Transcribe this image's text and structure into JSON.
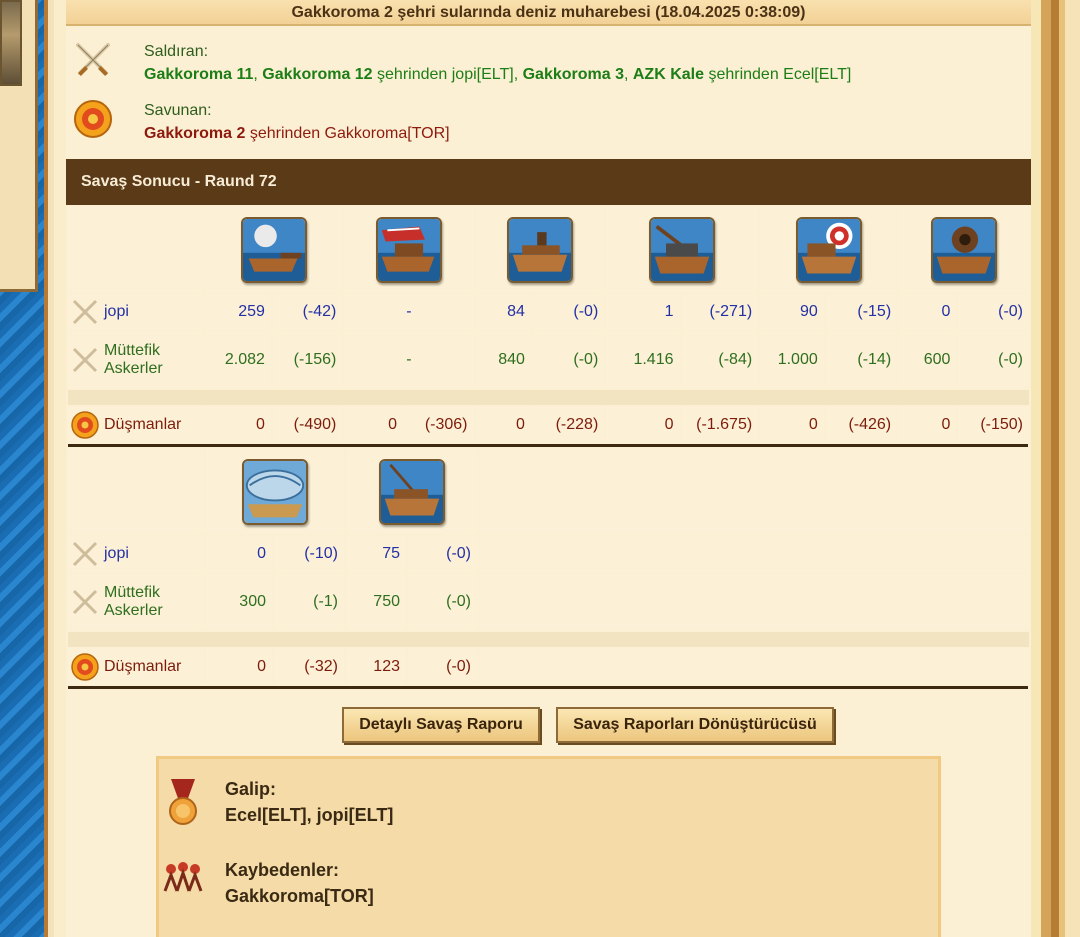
{
  "title": "Gakkoroma 2 şehri sularında deniz muharebesi (18.04.2025 0:38:09)",
  "attacker": {
    "label": "Saldıran:",
    "city1": "Gakkoroma 11",
    "sep1": ", ",
    "city2": "Gakkoroma 12",
    "from1": " şehrinden jopi[ELT], ",
    "city3": "Gakkoroma 3",
    "sep2": ", ",
    "city4": "AZK Kale",
    "from2": " şehrinden Ecel[ELT]"
  },
  "defender": {
    "label": "Savunan:",
    "city": "Gakkoroma 2",
    "from": " şehrinden Gakkoroma[TOR]"
  },
  "result_header": "Savaş Sonucu - Raund 72",
  "section1": {
    "units": [
      "ram-ship",
      "fire-ship",
      "steam-ram",
      "ballista-ship",
      "catapult-ship",
      "mortar-ship"
    ],
    "rows": [
      {
        "name": "jopi",
        "cells": [
          "259",
          "(-42)",
          "-",
          "",
          "84",
          "(-0)",
          "1",
          "(-271)",
          "90",
          "(-15)",
          "0",
          "(-0)"
        ]
      },
      {
        "name1": "Müttefik",
        "name2": "Askerler",
        "cells": [
          "2.082",
          "(-156)",
          "-",
          "",
          "840",
          "(-0)",
          "1.416",
          "(-84)",
          "1.000",
          "(-14)",
          "600",
          "(-0)"
        ]
      },
      {
        "name": "Düşmanlar",
        "cells": [
          "0",
          "(-490)",
          "0",
          "(-306)",
          "0",
          "(-228)",
          "0",
          "(-1.675)",
          "0",
          "(-426)",
          "0",
          "(-150)"
        ]
      }
    ]
  },
  "section2": {
    "units": [
      "paddle-speedboat",
      "diving-boat"
    ],
    "rows": [
      {
        "name": "jopi",
        "cells": [
          "0",
          "(-10)",
          "75",
          "(-0)"
        ]
      },
      {
        "name1": "Müttefik",
        "name2": "Askerler",
        "cells": [
          "300",
          "(-1)",
          "750",
          "(-0)"
        ]
      },
      {
        "name": "Düşmanlar",
        "cells": [
          "0",
          "(-32)",
          "123",
          "(-0)"
        ]
      }
    ]
  },
  "buttons": {
    "detailed": "Detaylı Savaş Raporu",
    "converter": "Savaş Raporları Dönüştürücüsü"
  },
  "outcome": {
    "winner_label": "Galip:",
    "winners": "Ecel[ELT], jopi[ELT]",
    "loser_label": "Kaybedenler:",
    "losers": "Gakkoroma[TOR]"
  },
  "colors": {
    "header_bg": "#5b3a17",
    "panel_bg": "#fbf0d3",
    "attacker_green": "#1d7d16",
    "defender_red": "#8e1a0e",
    "jopi_blue": "#2330a6"
  }
}
